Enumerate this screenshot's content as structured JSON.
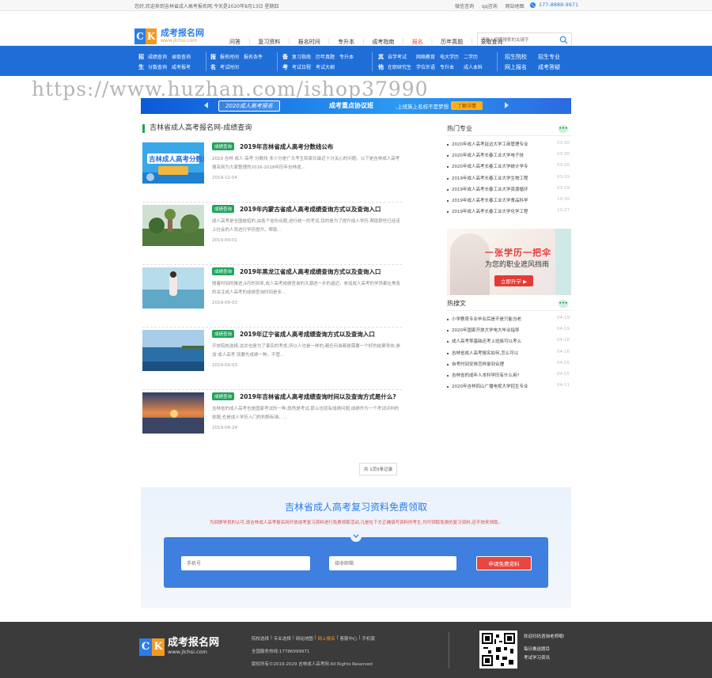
{
  "topbar": {
    "welcome": "您好,欢迎来到吉林省成人高考报名网,今天是2020年8月13日 星期四",
    "links": [
      "微信咨询",
      "qq咨询",
      "网站地图"
    ],
    "phone": "177-8888-9971"
  },
  "header": {
    "logo_name": "成考报名网",
    "logo_url": "www.jlchsi.com",
    "nav": [
      "问答",
      "复习资料",
      "报名时间",
      "专升本",
      "成考指南",
      "报名",
      "历年真题",
      "录取查询"
    ],
    "active_nav": "报名",
    "search_placeholder": "请输入您要搜索的关键字"
  },
  "bluenav": {
    "groups": [
      {
        "label": "招生",
        "items": [
          "成绩查询",
          "录取查询",
          "分数查询",
          "成考报考"
        ]
      },
      {
        "label": "报名",
        "items": [
          "报名时间",
          "报名条件",
          "考试时间"
        ]
      },
      {
        "label": "备考",
        "items": [
          "复习指南",
          "历年真题",
          "专升本",
          "考试日程",
          "考试大纲"
        ]
      },
      {
        "label": "其他",
        "items": [
          "自学考试",
          "网络教育",
          "电大学历",
          "二学历",
          "在职研究生",
          "学位外语",
          "专升本",
          "成人本科"
        ]
      }
    ],
    "right": [
      "招生院校",
      "招生专业",
      "网上报名",
      "成考答疑"
    ]
  },
  "watermark": "https://www.huzhan.com/ishop37990",
  "banner": {
    "tag": "2020成人高考报名",
    "slogan": "成考重点协议班",
    "slogan2": ",上班族上名校不是梦想",
    "button": "了解详情"
  },
  "crumb": "吉林省成人高考报名网-成绩查询",
  "articles": [
    {
      "badge": "成绩查询",
      "title": "2019年吉林省成人高考分数线公布",
      "excerpt": "2019 吉林 成人 高考 分数线 多少分是广大考生和家长最近十分关心的问题。以下是吉林成人高考报名网为大家整理的2016-2018年历年吉林成...",
      "date": "2019-12-04",
      "thumb_text": "吉林成人高考分数线"
    },
    {
      "badge": "成绩查询",
      "title": "2019年内蒙古省成人高考成绩查询方式以及查询入口",
      "excerpt": "成人高考是全国统招的,由各个省份出题,进行统一的考试,目的是为了提升成人学历,帮助那些已经走上社会的人员进行学历提升。帮助...",
      "date": "2019-09-01",
      "thumb_text": ""
    },
    {
      "badge": "成绩查询",
      "title": "2019年黑龙江省成人高考成绩查询方式以及查询入口",
      "excerpt": "随着时间的推进,9月的到来,成人高考成绩查询的大潮进一步的逼近。参加成人高考的学员都在焦急的关注成人高考的成绩查询时间是多…",
      "date": "2019-09-03",
      "thumb_text": ""
    },
    {
      "badge": "成绩查询",
      "title": "2019年辽宁省成人高考成绩查询方式以及查询入口",
      "excerpt": "开放院校选择,这并也是为了事实的考虑,所以人也是一样的,都任何准都是需要一个好的结果导向,参加 成人高考 就要先成绩一种。不管...",
      "date": "2019-09-03",
      "thumb_text": ""
    },
    {
      "badge": "成绩查询",
      "title": "2019年吉林省成人高考成绩查询时间以及查询方式是什么?",
      "excerpt": "吉林省的成人高考也是国家考试的一种,既然是考试,那么也就有成绩问题,成绩作为一个考试评判的依据,也是成人学历入门的判断标准。...",
      "date": "2019-08-24",
      "thumb_text": ""
    }
  ],
  "pager": "共 1页5条记录",
  "hot_majors": {
    "title": "热门专业",
    "items": [
      {
        "text": "2020年成人高考延边大学工商管理专业",
        "date": "03-30"
      },
      {
        "text": "2020年成人高考长春工业大学电子技",
        "date": "03-30"
      },
      {
        "text": "2020年成人高考长春工业大学统计学专",
        "date": "03-20"
      },
      {
        "text": "2019年成人高考长春工业大学生物工程",
        "date": "03-19"
      },
      {
        "text": "2019年成人高考长春工业大学资源循环",
        "date": "03-19"
      },
      {
        "text": "2019年成人高考长春工业大学食品科学",
        "date": "10-30"
      },
      {
        "text": "2019年成人高考长春工业大学化学工程",
        "date": "10-27"
      }
    ]
  },
  "ad": {
    "line1": "一张学历一把伞",
    "line2": "为您的职业遮风挡雨",
    "button": "立即升学"
  },
  "hot_articles": {
    "title": "热搜文",
    "items": [
      {
        "text": "小学教育专业毕业后是不是只能当老",
        "date": "04-19"
      },
      {
        "text": "2020年国家开放大学电大毕业指导",
        "date": "04-19"
      },
      {
        "text": "成人高考零基础还考上班族可以考么",
        "date": "04-16"
      },
      {
        "text": "吉林省成人高考报名如何,怎么可以",
        "date": "04-16"
      },
      {
        "text": "自考时间安排怎样录到合理",
        "date": "04-15"
      },
      {
        "text": "吉林省的成年人本科学历有什么用?",
        "date": "04-15"
      },
      {
        "text": "2020年吉林四山广播电视大学招生专业",
        "date": "04-11"
      }
    ]
  },
  "form": {
    "title": "吉林省成人高考复习资料免费领取",
    "subtitle": "为回馈学员的认可,现吉林成人高考报名网开放成考复习资料进行免费领取活动,凡是在下方正确填写资料的考生,均可领取免费的复习资料,还不快来领取。",
    "phone_placeholder": "手机号",
    "email_placeholder": "接收邮箱",
    "submit": "申请免费资料"
  },
  "footer": {
    "logo_name": "成考报名网",
    "logo_url": "www.jlchsi.com",
    "links": [
      "院校选择",
      "专业选择",
      "网站地图",
      "网上报名",
      "客服中心",
      "手机版"
    ],
    "highlight_link": "网上报名",
    "hotline": "全国服务热线:17786999971",
    "copyright": "版权所有©2019-2029 吉林成人高考网 All Rights Reserved",
    "qr_line1": "欢迎扫码咨询老师哦!",
    "qr_line2": "每日推送题目",
    "qr_line3": "考试学习资讯"
  },
  "colors": {
    "brand_blue": "#2b7de9",
    "nav_blue": "#1f6ed8",
    "accent_green": "#21a35a",
    "accent_red": "#e9463f",
    "accent_orange": "#f49a21"
  }
}
